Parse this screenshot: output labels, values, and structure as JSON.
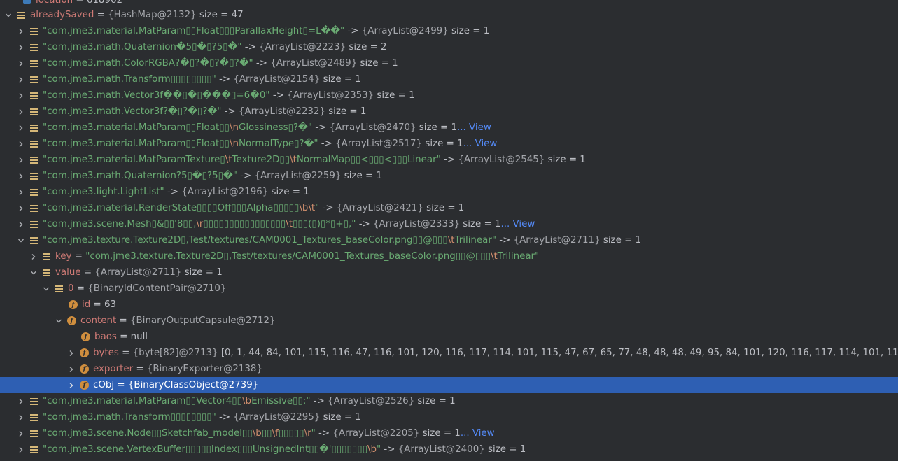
{
  "partial_top_row": {
    "name": "location",
    "value": "618962"
  },
  "root": {
    "name": "alreadySaved",
    "type": "{HashMap@2132}",
    "size": "size = 47"
  },
  "entries": [
    {
      "parts": [
        "\"com.jme3.material.MatParam▯▯Float▯▯▯ParallaxHeight▯=L��\""
      ],
      "type": "{ArrayList@2499}",
      "size": "size = 1",
      "view": ""
    },
    {
      "parts": [
        "\"com.jme3.math.Quaternion�5▯�▯?5▯�\""
      ],
      "type": "{ArrayList@2223}",
      "size": "size = 2",
      "view": ""
    },
    {
      "parts": [
        "\"com.jme3.math.ColorRGBA?�▯?�▯?�▯?�\""
      ],
      "type": "{ArrayList@2489}",
      "size": "size = 1",
      "view": ""
    },
    {
      "parts": [
        "\"com.jme3.math.Transform▯▯▯▯▯▯▯▯\""
      ],
      "type": "{ArrayList@2154}",
      "size": "size = 1",
      "view": ""
    },
    {
      "parts": [
        "\"com.jme3.math.Vector3f��▯�▯���▯=6�0\""
      ],
      "type": "{ArrayList@2353}",
      "size": "size = 1",
      "view": ""
    },
    {
      "parts": [
        "\"com.jme3.math.Vector3f?�▯?�▯?�\""
      ],
      "type": "{ArrayList@2232}",
      "size": "size = 1",
      "view": ""
    },
    {
      "parts": [
        "\"com.jme3.material.MatParam▯▯Float▯▯",
        "\\n",
        "Glossiness▯?�\""
      ],
      "type": "{ArrayList@2470}",
      "size": "size = 1",
      "view": "View"
    },
    {
      "parts": [
        "\"com.jme3.material.MatParam▯▯Float▯▯",
        "\\n",
        "NormalType▯?�\""
      ],
      "type": "{ArrayList@2517}",
      "size": "size = 1",
      "view": "View"
    },
    {
      "parts": [
        "\"com.jme3.material.MatParamTexture▯",
        "\\t",
        "Texture2D▯▯",
        "\\t",
        "NormalMap▯▯<▯▯▯<▯▯▯Linear\""
      ],
      "type": "{ArrayList@2545}",
      "size": "size = 1",
      "view": ""
    },
    {
      "parts": [
        "\"com.jme3.math.Quaternion?5▯�▯?5▯�\""
      ],
      "type": "{ArrayList@2259}",
      "size": "size = 1",
      "view": ""
    },
    {
      "parts": [
        "\"com.jme3.light.LightList\""
      ],
      "type": "{ArrayList@2196}",
      "size": "size = 1",
      "view": ""
    },
    {
      "parts": [
        "\"com.jme3.material.RenderState▯▯▯▯Off▯▯▯Alpha▯▯▯▯▯",
        "\\b\\t",
        "\""
      ],
      "type": "{ArrayList@2421}",
      "size": "size = 1",
      "view": ""
    },
    {
      "parts": [
        "\"com.jme3.scene.Mesh▯&▯▯'8▯▯,",
        "\\r",
        "▯▯▯▯▯▯▯▯▯▯▯▯▯▯▯▯",
        "\\t",
        "▯▯▯(▯)▯*▯+▯,\""
      ],
      "type": "{ArrayList@2333}",
      "size": "size = 1",
      "view": "View"
    }
  ],
  "expanded_entry": {
    "parts": [
      "\"com.jme3.texture.Texture2D▯,Test/textures/CAM0001_Textures_baseColor.png▯▯@▯▯▯",
      "\\t",
      "Trilinear\""
    ],
    "type": "{ArrayList@2711}",
    "size": "size = 1",
    "key": {
      "name": "key",
      "parts": [
        "\"com.jme3.texture.Texture2D▯,Test/textures/CAM0001_Textures_baseColor.png▯▯@▯▯▯",
        "\\t",
        "Trilinear\""
      ]
    },
    "value": {
      "name": "value",
      "type": "{ArrayList@2711}",
      "size": "size = 1"
    },
    "item0": {
      "name": "0",
      "type": "{BinaryIdContentPair@2710}"
    },
    "id": {
      "name": "id",
      "value": "63"
    },
    "content": {
      "name": "content",
      "type": "{BinaryOutputCapsule@2712}"
    },
    "baos": {
      "name": "baos",
      "value": "null"
    },
    "bytes": {
      "name": "bytes",
      "type": "{byte[82]@2713}",
      "value": "[0, 1, 44, 84, 101, 115, 116, 47, 116, 101, 120, 116, 117, 114, 101, 115, 47, 67, 65, 77, 48, 48, 48, 49, 95, 84, 101, 120, 116, 117, 114, 101, 115, 95, 98, 97, 115, 101, 67, 111"
    },
    "exporter": {
      "name": "exporter",
      "type": "{BinaryExporter@2138}"
    },
    "cObj": {
      "name": "cObj",
      "type": "{BinaryClassObject@2739}"
    }
  },
  "entries_after": [
    {
      "parts": [
        "\"com.jme3.material.MatParam▯▯Vector4▯▯",
        "\\b",
        "Emissive▯▯:\""
      ],
      "type": "{ArrayList@2526}",
      "size": "size = 1",
      "view": ""
    },
    {
      "parts": [
        "\"com.jme3.math.Transform▯▯▯▯▯▯▯▯\""
      ],
      "type": "{ArrayList@2295}",
      "size": "size = 1",
      "view": ""
    },
    {
      "parts": [
        "\"com.jme3.scene.Node▯▯Sketchfab_model▯▯",
        "\\b",
        "▯▯",
        "\\f",
        "▯▯▯▯▯",
        "\\r",
        "\""
      ],
      "type": "{ArrayList@2205}",
      "size": "size = 1",
      "view": "View"
    },
    {
      "parts": [
        "\"com.jme3.scene.VertexBuffer▯▯▯▯▯Index▯▯▯UnsignedInt▯▯�'▯▯▯▯▯▯▯",
        "\\b",
        "\""
      ],
      "type": "{ArrayList@2400}",
      "size": "size = 1",
      "view": ""
    }
  ],
  "labels": {
    "arrow": " -> ",
    "equals": " = ",
    "dots": "... "
  },
  "colors": {
    "background": "#2b2d30",
    "selection": "#2e5fb3",
    "string": "#6aab73",
    "escape": "#cf8e6d",
    "name": "#d07b76",
    "link": "#548af7",
    "field_icon": "#cf8e3e",
    "list_icon": "#d5b778"
  }
}
